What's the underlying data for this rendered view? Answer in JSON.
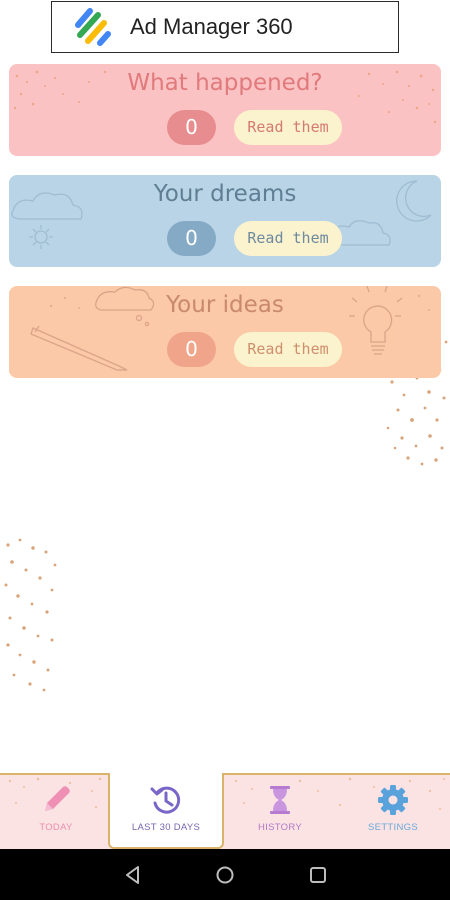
{
  "ad": {
    "title": "Ad Manager 360",
    "logo_icon": "google-ad-manager-logo",
    "logo_colors": [
      "#4285f4",
      "#34a853",
      "#fbbc05",
      "#ea4335"
    ]
  },
  "cards": {
    "happened": {
      "title": "What happened?",
      "count": "0",
      "button_label": "Read them",
      "background": "#fbc2c3",
      "accent": "#e88d8f"
    },
    "dreams": {
      "title": "Your dreams",
      "count": "0",
      "button_label": "Read them",
      "background": "#b8d4e6",
      "accent": "#84aac6"
    },
    "ideas": {
      "title": "Your ideas",
      "count": "0",
      "button_label": "Read them",
      "background": "#fbc9a8",
      "accent": "#f0a58a"
    }
  },
  "bottom_nav": {
    "active": "last_30_days",
    "items": [
      {
        "key": "today",
        "label": "TODAY",
        "icon": "pencil-icon",
        "color": "#e98eb0"
      },
      {
        "key": "last_30_days",
        "label": "LAST 30 DAYS",
        "icon": "history-clock-icon",
        "color": "#7a66b0"
      },
      {
        "key": "history",
        "label": "HISTORY",
        "icon": "hourglass-icon",
        "color": "#b278c6"
      },
      {
        "key": "settings",
        "label": "SETTINGS",
        "icon": "gear-icon",
        "color": "#6aa8d8"
      }
    ]
  },
  "system_nav": {
    "buttons": [
      "back-icon",
      "home-icon",
      "recents-icon"
    ]
  }
}
